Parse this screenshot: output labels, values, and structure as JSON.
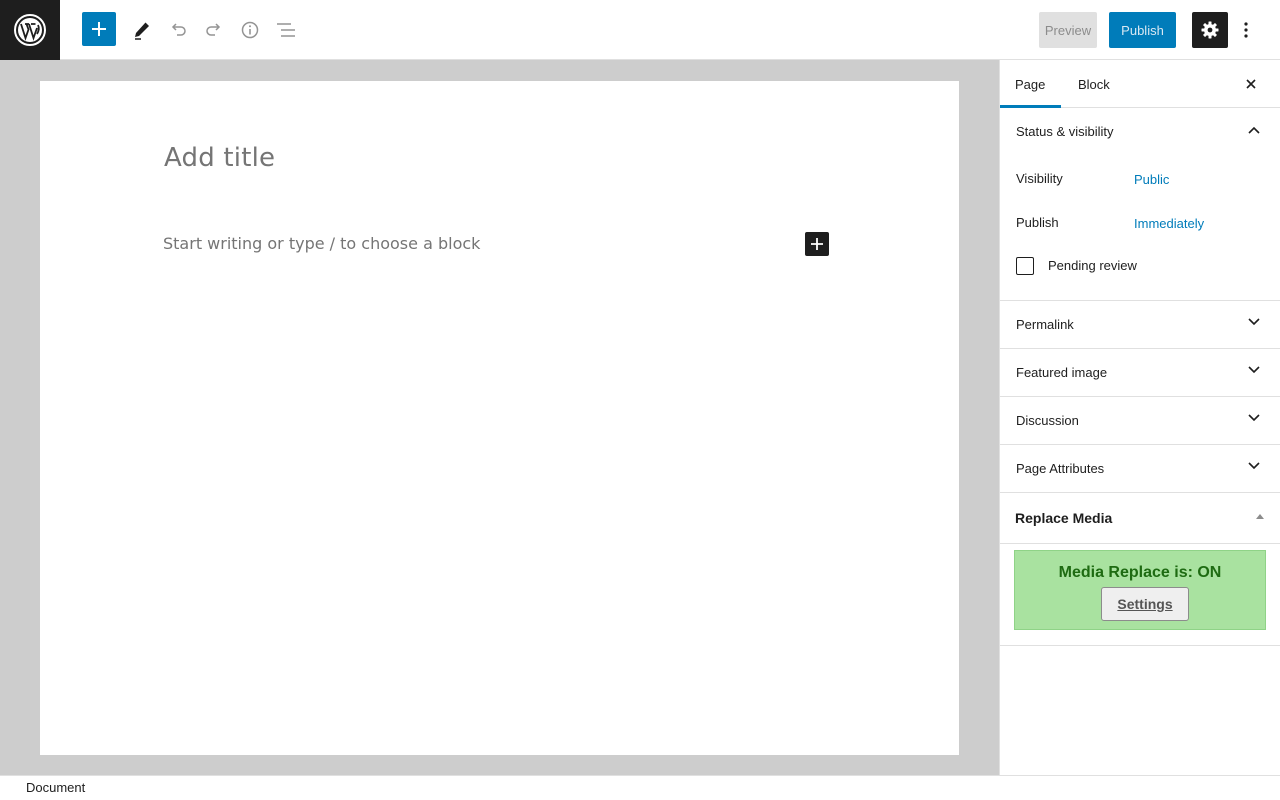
{
  "toolbar": {
    "preview_label": "Preview",
    "publish_label": "Publish",
    "icons": [
      "wordpress-icon",
      "plus-icon",
      "pencil-icon",
      "undo-icon",
      "redo-icon",
      "info-icon",
      "list-view-icon",
      "gear-icon",
      "more-vertical-icon"
    ]
  },
  "editor": {
    "title_placeholder": "Add title",
    "paragraph_placeholder": "Start writing or type / to choose a block"
  },
  "sidebar": {
    "tabs": [
      {
        "label": "Page",
        "active": true
      },
      {
        "label": "Block",
        "active": false
      }
    ],
    "status_visibility": {
      "title": "Status & visibility",
      "visibility_label": "Visibility",
      "visibility_value": "Public",
      "publish_label": "Publish",
      "publish_value": "Immediately",
      "pending_review_label": "Pending review",
      "pending_review_checked": false
    },
    "panels": [
      {
        "label": "Permalink"
      },
      {
        "label": "Featured image"
      },
      {
        "label": "Discussion"
      },
      {
        "label": "Page Attributes"
      }
    ],
    "replace_media": {
      "title": "Replace Media",
      "status_text": "Media Replace is:  ON",
      "settings_label": "Settings"
    }
  },
  "footer": {
    "breadcrumb": "Document"
  },
  "colors": {
    "accent": "#007cba",
    "dark": "#1e1e1e",
    "canvas_bg": "#cdcdcd",
    "media_box_bg": "#a9e2a0",
    "media_text": "#1e6b12"
  }
}
